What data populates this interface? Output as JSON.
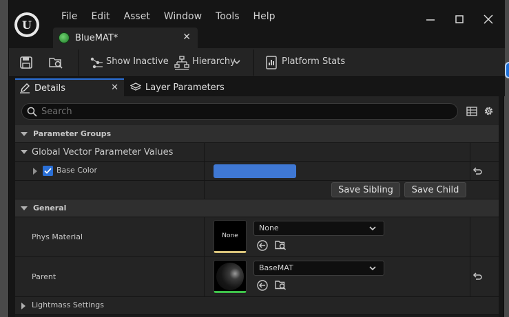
{
  "menu": [
    "File",
    "Edit",
    "Asset",
    "Window",
    "Tools",
    "Help"
  ],
  "document_tab": {
    "label": "BlueMAT*"
  },
  "toolbar": {
    "show_inactive": "Show Inactive",
    "hierarchy": "Hierarchy",
    "platform_stats": "Platform Stats"
  },
  "panel_tabs": {
    "details": "Details",
    "layer_parameters": "Layer Parameters"
  },
  "search": {
    "placeholder": "Search"
  },
  "sections": {
    "parameter_groups": "Parameter Groups",
    "global_vector": "Global Vector Parameter Values",
    "base_color": "Base Color",
    "save_sibling": "Save Sibling",
    "save_child": "Save Child",
    "general": "General",
    "phys_material": "Phys Material",
    "phys_thumb": "None",
    "phys_value": "None",
    "parent": "Parent",
    "parent_value": "BaseMAT",
    "lightmass": "Lightmass Settings"
  },
  "colors": {
    "base_color": "#3f78d4",
    "accent": "#2a6fd6"
  }
}
